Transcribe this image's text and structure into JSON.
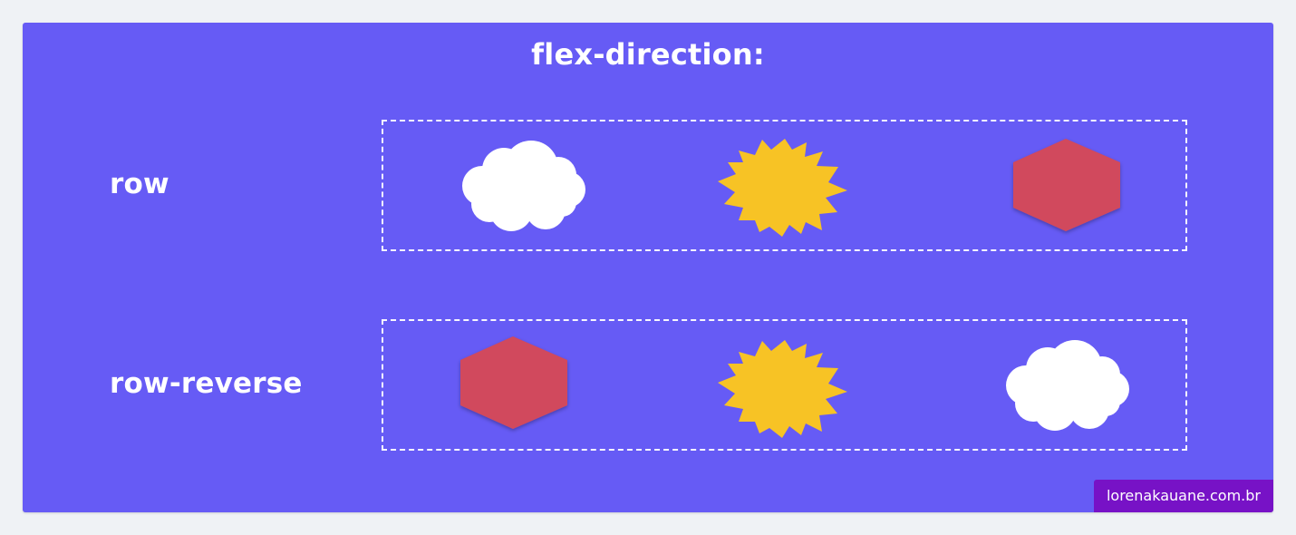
{
  "title": "flex-direction:",
  "rows": [
    {
      "label": "row",
      "items": [
        "cloud",
        "starburst",
        "hexagon"
      ]
    },
    {
      "label": "row-reverse",
      "items": [
        "hexagon",
        "starburst",
        "cloud"
      ]
    }
  ],
  "credit": "lorenakauane.com.br",
  "colors": {
    "background": "#665bf5",
    "page": "#eff2f5",
    "cloud": "#ffffff",
    "starburst": "#f7c325",
    "hexagon": "#d1485d",
    "credit_badge": "#7712c6"
  }
}
